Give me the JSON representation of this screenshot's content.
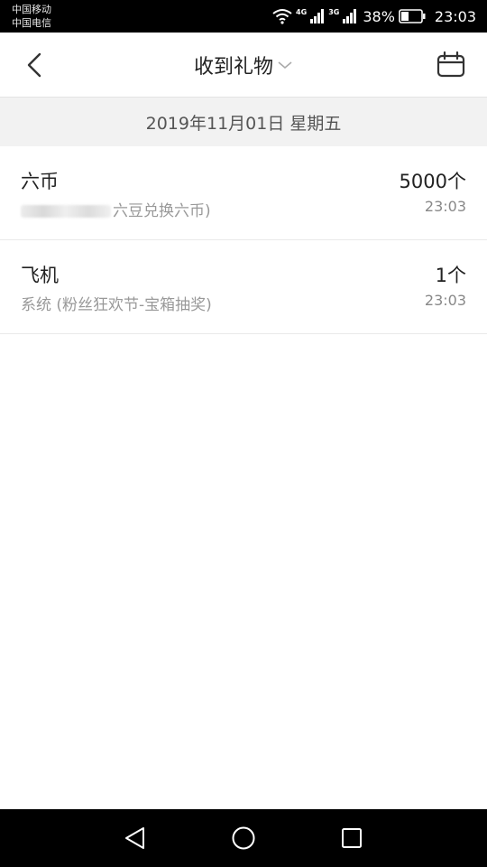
{
  "status_bar": {
    "carrier_1": "中国移动",
    "carrier_2": "中国电信",
    "network_1": "4G",
    "network_2": "3G",
    "battery": "38%",
    "battery_level": 0.38,
    "time": "23:03"
  },
  "header": {
    "title": "收到礼物",
    "icons": {
      "back": "chevron-left-icon",
      "dropdown": "chevron-down-icon",
      "calendar": "calendar-icon"
    }
  },
  "date_band": {
    "text": "2019年11月01日 星期五"
  },
  "gifts": [
    {
      "name": "六币",
      "source": "六豆兑换六币)",
      "source_obscured": true,
      "count": "5000个",
      "time": "23:03"
    },
    {
      "name": "飞机",
      "source": "系统 (粉丝狂欢节-宝箱抽奖)",
      "source_obscured": false,
      "count": "1个",
      "time": "23:03"
    }
  ],
  "nav_bar": {
    "icons": [
      "back-triangle-icon",
      "home-circle-icon",
      "recents-square-icon"
    ]
  },
  "colors": {
    "text_primary": "#222222",
    "text_secondary": "#999999",
    "band_bg": "#f2f2f2",
    "bars": "#000000"
  }
}
